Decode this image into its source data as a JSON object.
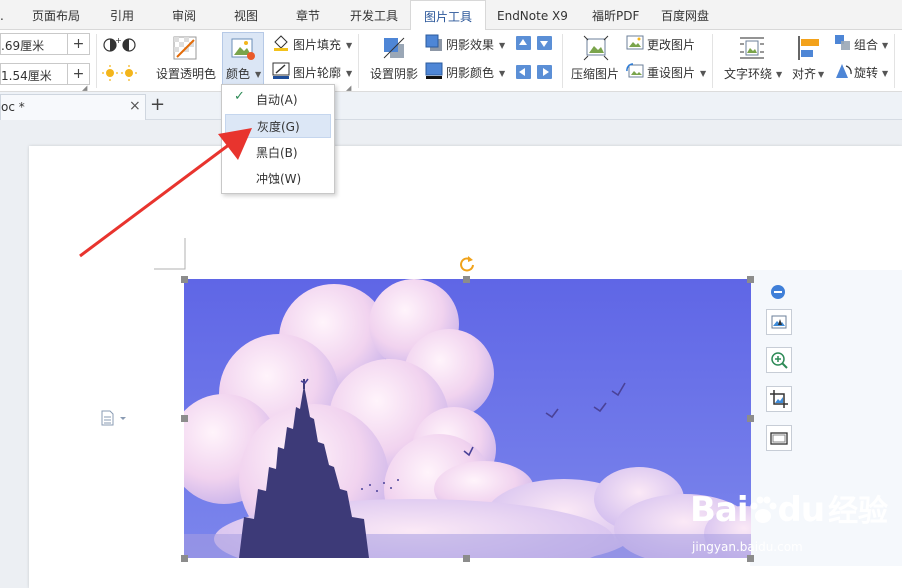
{
  "ribbon_tabs": [
    {
      "label": "页面布局"
    },
    {
      "label": "引用"
    },
    {
      "label": "审阅"
    },
    {
      "label": "视图"
    },
    {
      "label": "章节"
    },
    {
      "label": "开发工具"
    },
    {
      "label": "图片工具",
      "active": true
    },
    {
      "label": "EndNote X9"
    },
    {
      "label": "福昕PDF"
    },
    {
      "label": "百度网盘"
    }
  ],
  "size": {
    "height": ".69厘米",
    "width": "1.54厘米"
  },
  "buttons": {
    "set_transparent": "设置透明色",
    "color": "颜色",
    "picture_fill": "图片填充",
    "picture_outline": "图片轮廓",
    "set_shadow": "设置阴影",
    "shadow_effect": "阴影效果",
    "shadow_color": "阴影颜色",
    "compress": "压缩图片",
    "change_picture": "更改图片",
    "reset_picture": "重设图片",
    "text_wrap": "文字环绕",
    "align": "对齐",
    "group": "组合",
    "rotate": "旋转"
  },
  "doc_tab": {
    "title": "oc *",
    "close": "×",
    "add": "+"
  },
  "color_menu": {
    "items": [
      {
        "label": "自动(A)",
        "checked": true
      },
      {
        "label": "灰度(G)",
        "highlighted": true
      },
      {
        "label": "黑白(B)"
      },
      {
        "label": "冲蚀(W)"
      }
    ]
  },
  "watermark": {
    "brand_a": "Bai",
    "brand_b": "du",
    "brand_cn": "经验",
    "url": "jingyan.baidu.com"
  },
  "colors": {
    "accent": "#2b579a",
    "arrow": "#e8342e",
    "sky": "#6a73e8",
    "menu_highlight": "#dce7f6"
  }
}
